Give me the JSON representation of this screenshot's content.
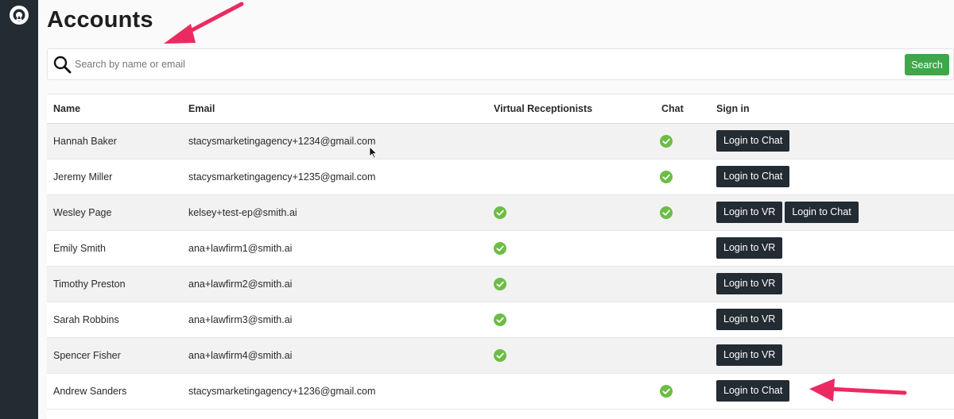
{
  "page": {
    "title": "Accounts"
  },
  "search": {
    "placeholder": "Search by name or email",
    "button_label": "Search"
  },
  "table": {
    "columns": [
      "Name",
      "Email",
      "Virtual Receptionists",
      "Chat",
      "Sign in"
    ],
    "rows": [
      {
        "name": "Hannah Baker",
        "email": "stacysmarketingagency+1234@gmail.com",
        "vr": false,
        "chat": true,
        "buttons": [
          "Login to Chat"
        ]
      },
      {
        "name": "Jeremy Miller",
        "email": "stacysmarketingagency+1235@gmail.com",
        "vr": false,
        "chat": true,
        "buttons": [
          "Login to Chat"
        ]
      },
      {
        "name": "Wesley Page",
        "email": "kelsey+test-ep@smith.ai",
        "vr": true,
        "chat": true,
        "buttons": [
          "Login to VR",
          "Login to Chat"
        ]
      },
      {
        "name": "Emily Smith",
        "email": "ana+lawfirm1@smith.ai",
        "vr": true,
        "chat": false,
        "buttons": [
          "Login to VR"
        ]
      },
      {
        "name": "Timothy Preston",
        "email": "ana+lawfirm2@smith.ai",
        "vr": true,
        "chat": false,
        "buttons": [
          "Login to VR"
        ]
      },
      {
        "name": "Sarah Robbins",
        "email": "ana+lawfirm3@smith.ai",
        "vr": true,
        "chat": false,
        "buttons": [
          "Login to VR"
        ]
      },
      {
        "name": "Spencer Fisher",
        "email": "ana+lawfirm4@smith.ai",
        "vr": true,
        "chat": false,
        "buttons": [
          "Login to VR"
        ]
      },
      {
        "name": "Andrew Sanders",
        "email": "stacysmarketingagency+1236@gmail.com",
        "vr": false,
        "chat": true,
        "buttons": [
          "Login to Chat"
        ]
      }
    ]
  },
  "icons": {
    "logo": "app-logo-icon",
    "search": "search-icon",
    "check": "check-circle-icon"
  },
  "colors": {
    "sidebar": "#232b33",
    "button_dark": "#232b33",
    "search_button": "#3fa64a",
    "check": "#6cbd45",
    "annotation_arrow": "#ec2a62"
  }
}
